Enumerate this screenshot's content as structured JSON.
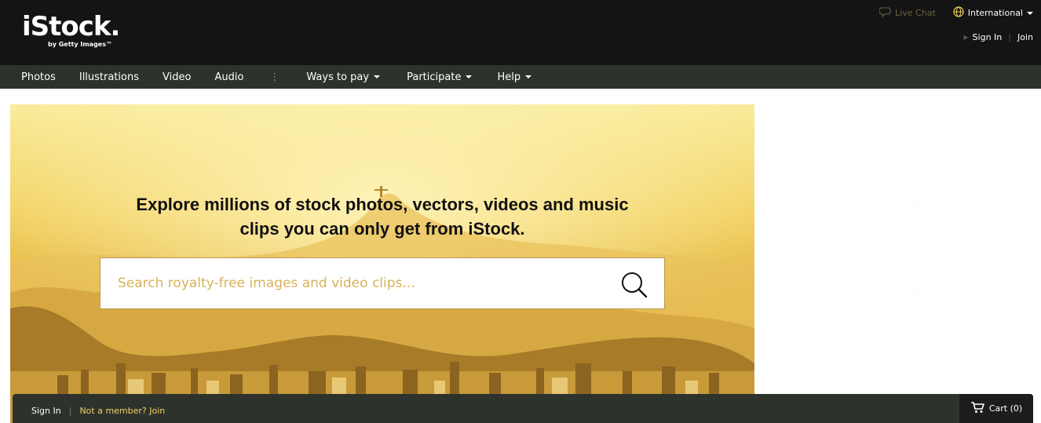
{
  "header": {
    "logo_text": "iStock.",
    "logo_subtext": "by Getty Images™",
    "live_chat_label": "Live Chat",
    "language_label": "International",
    "sign_in_label": "Sign In",
    "join_label": "Join"
  },
  "nav": {
    "items": [
      {
        "label": "Photos"
      },
      {
        "label": "Illustrations"
      },
      {
        "label": "Video"
      },
      {
        "label": "Audio"
      },
      {
        "label": "Ways to pay"
      },
      {
        "label": "Participate"
      },
      {
        "label": "Help"
      }
    ]
  },
  "hero": {
    "headline_line1": "Explore millions of stock photos, vectors, videos and music",
    "headline_line2": "clips you can only get from iStock.",
    "search_placeholder": "Search royalty-free images and video clips..."
  },
  "footer_bar": {
    "sign_in_label": "Sign In",
    "member_prompt": "Not a member? Join",
    "cart_label": "Cart (0)"
  },
  "colors": {
    "header_bg": "#141414",
    "nav_bg": "#2e322d",
    "accent_gold": "#f2d060",
    "live_chat_text": "#6b6540"
  },
  "icons": {
    "live_chat": "chat-bubble-icon",
    "language": "globe-icon",
    "search": "search-icon",
    "cart": "cart-icon"
  }
}
